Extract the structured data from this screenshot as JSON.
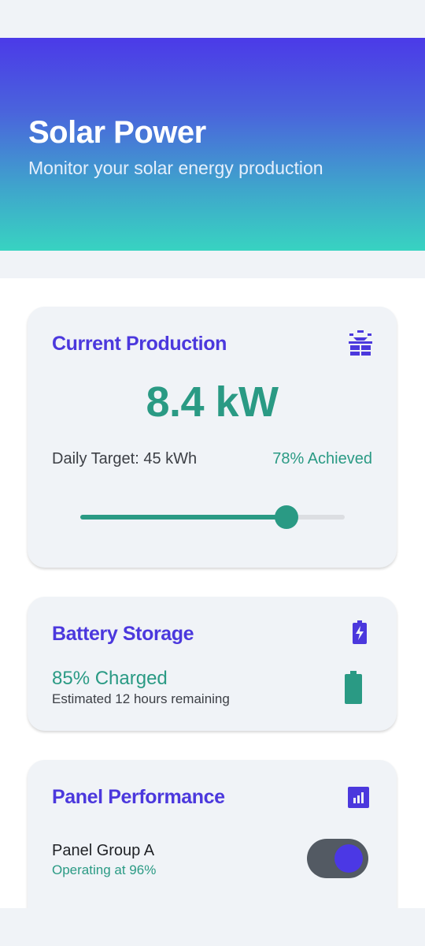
{
  "header": {
    "title": "Solar Power",
    "subtitle": "Monitor your solar energy production"
  },
  "production": {
    "title": "Current Production",
    "icon": "solar-panel-icon",
    "value": "8.4 kW",
    "target_label": "Daily Target: 45 kWh",
    "achieved_label": "78% Achieved",
    "slider_fraction": 0.78
  },
  "battery": {
    "title": "Battery Storage",
    "icon": "battery-charging-icon",
    "charged_label": "85% Charged",
    "remaining_label": "Estimated 12 hours remaining",
    "side_icon": "battery-full-icon"
  },
  "panels": {
    "title": "Panel Performance",
    "icon": "bar-chart-icon",
    "group": {
      "name": "Panel Group A",
      "status": "Operating at 96%",
      "toggle_on": true
    }
  },
  "colors": {
    "accent": "#4b38dd",
    "teal": "#2a9a84",
    "toggle_track": "#535a63"
  }
}
